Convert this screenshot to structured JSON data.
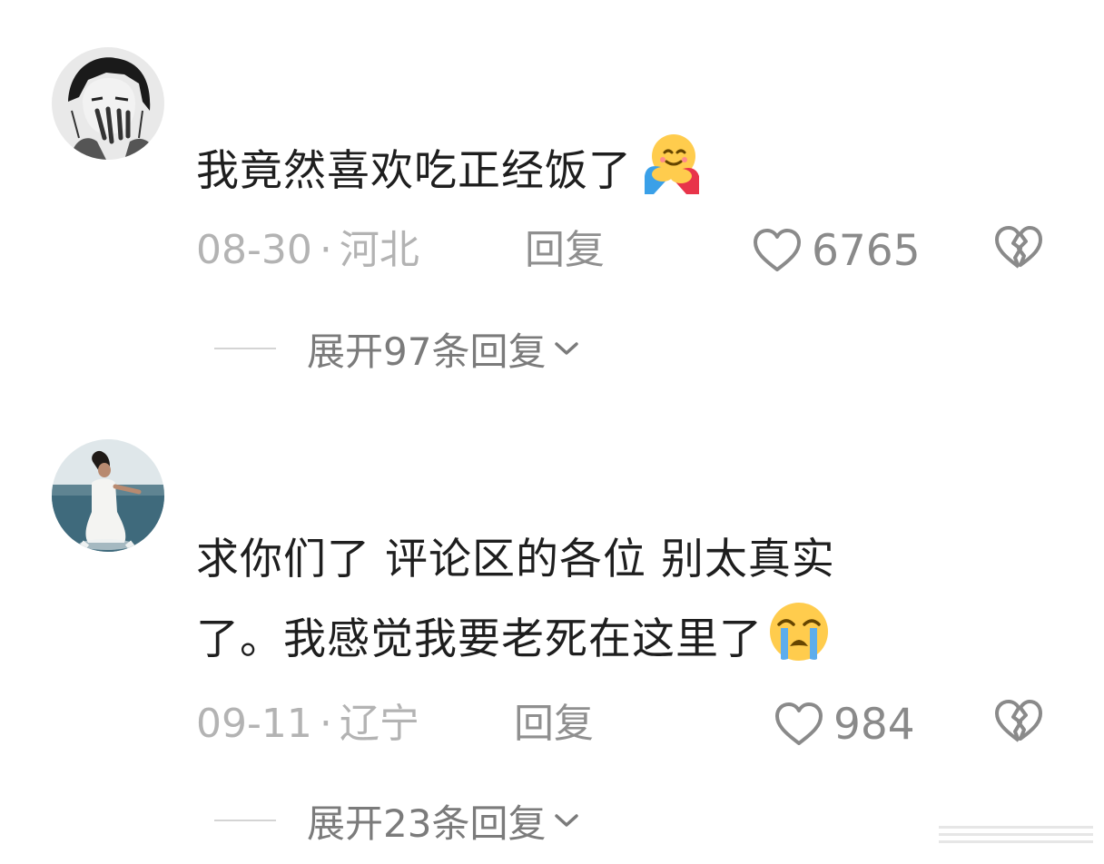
{
  "comments": [
    {
      "text": "我竟然喜欢吃正经饭了",
      "emoji": "hugging-face-emoji",
      "date": "08-30",
      "separator": "·",
      "location": "河北",
      "reply_label": "回复",
      "likes": "6765",
      "expand_label": "展开97条回复"
    },
    {
      "text_line1": "求你们了 评论区的各位 别太真实",
      "text_line2": "了。我感觉我要老死在这里了",
      "emoji": "loudly-crying-face-emoji",
      "date": "09-11",
      "separator": "·",
      "location": "辽宁",
      "reply_label": "回复",
      "likes": "984",
      "expand_label": "展开23条回复"
    }
  ],
  "icons": {
    "like": "heart-outline-icon",
    "dislike": "broken-heart-icon",
    "expand": "chevron-down-icon"
  },
  "colors": {
    "text": "#1e1e1e",
    "meta": "#b3b3b3",
    "reply": "#8f8f8f",
    "icon": "#8a8a8a"
  }
}
